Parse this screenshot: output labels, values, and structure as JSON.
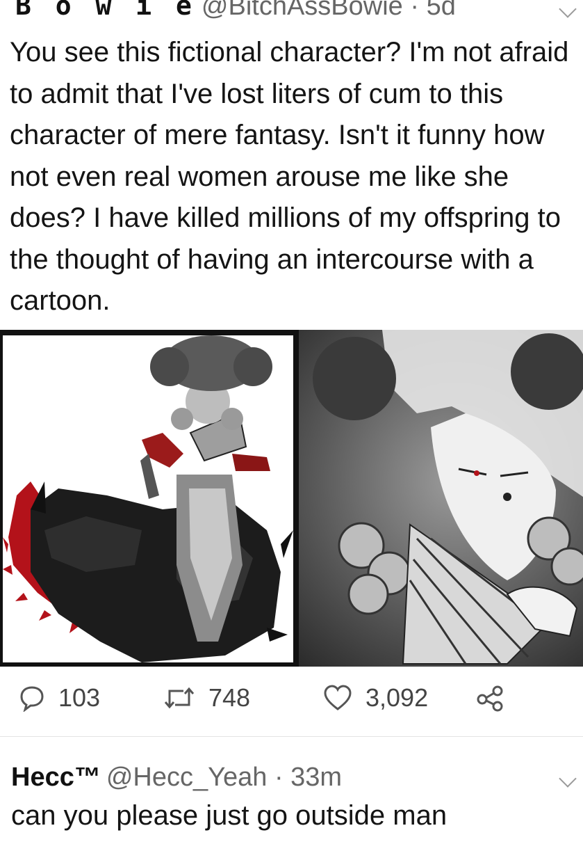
{
  "tweet": {
    "display_name": "B o w ı e",
    "handle_time": "@BitchAssBowie · 5d",
    "text": "You see this fictional character? I'm not afraid to admit that I've lost liters of cum to this character of mere fantasy. Isn't it funny how not even real women arouse me like she does? I have killed millions of my offspring to the thought of having an intercourse with a cartoon.",
    "images": [
      {
        "icon": "character-sprite-image"
      },
      {
        "icon": "character-portrait-image"
      }
    ],
    "actions": {
      "reply_count": "103",
      "retweet_count": "748",
      "like_count": "3,092",
      "reply_icon": "speech-bubble-icon",
      "retweet_icon": "retweet-icon",
      "like_icon": "heart-icon",
      "share_icon": "share-icon"
    }
  },
  "reply": {
    "display_name": "Hecc™",
    "handle_time": "@Hecc_Yeah · 33m",
    "text": "can you please just go outside man"
  },
  "colors": {
    "text": "#141414",
    "muted": "#666666",
    "icon": "#555555",
    "accent_red": "#b3121a"
  }
}
